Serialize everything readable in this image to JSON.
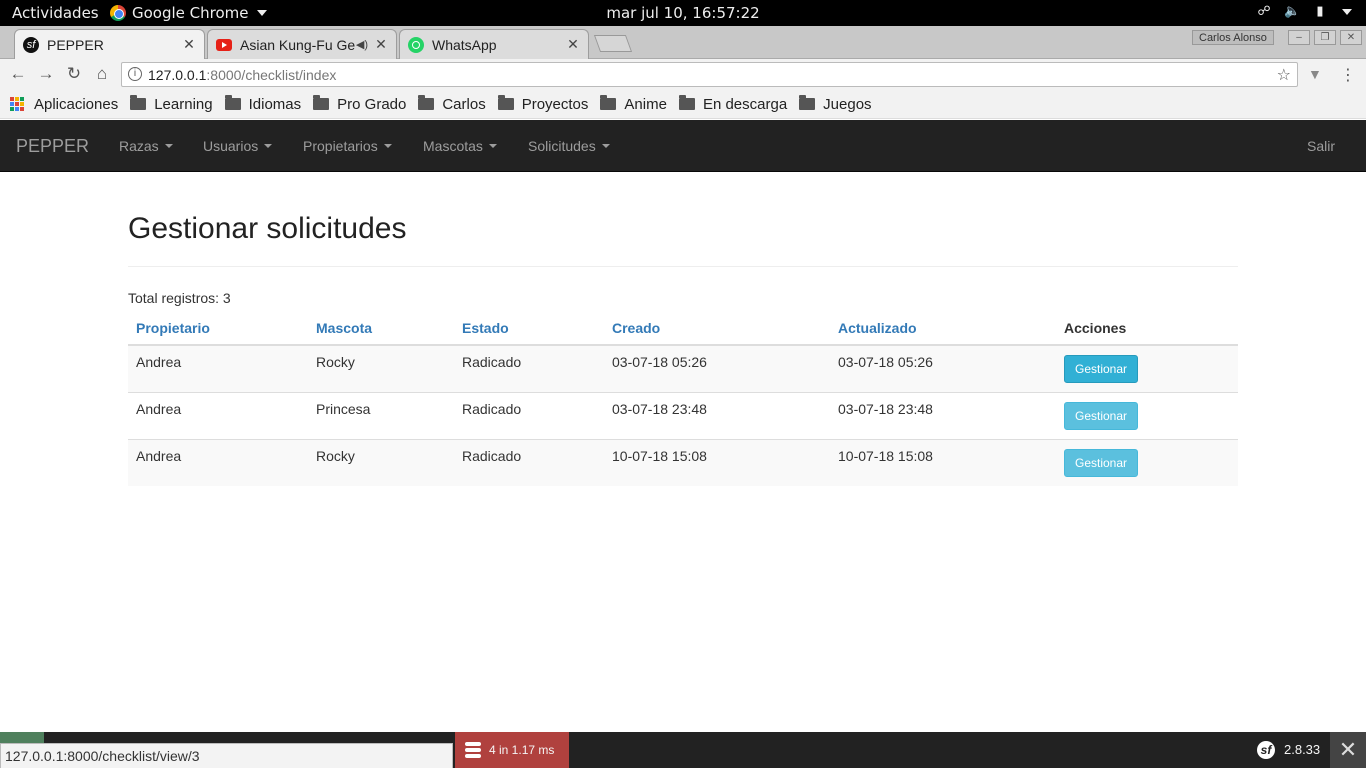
{
  "gnome": {
    "activities": "Actividades",
    "app": "Google Chrome",
    "clock": "mar jul 10, 16:57:22"
  },
  "tabs": [
    {
      "title": "PEPPER",
      "favicon": "symfony-icon"
    },
    {
      "title": "Asian Kung-Fu Ge",
      "favicon": "youtube-icon"
    },
    {
      "title": "WhatsApp",
      "favicon": "whatsapp-icon"
    }
  ],
  "profile": "Carlos Alonso",
  "address": {
    "host": "127.0.0.1",
    "rest": ":8000/checklist/index"
  },
  "bookmarks": [
    "Aplicaciones",
    "Learning",
    "Idiomas",
    "Pro Grado",
    "Carlos",
    "Proyectos",
    "Anime",
    "En descarga",
    "Juegos"
  ],
  "navbar": {
    "brand": "PEPPER",
    "items": [
      "Razas",
      "Usuarios",
      "Propietarios",
      "Mascotas",
      "Solicitudes"
    ],
    "logout": "Salir"
  },
  "page": {
    "title": "Gestionar solicitudes",
    "total": "Total registros: 3"
  },
  "table": {
    "headers": [
      "Propietario",
      "Mascota",
      "Estado",
      "Creado",
      "Actualizado",
      "Acciones"
    ],
    "rows": [
      {
        "propietario": "Andrea",
        "mascota": "Rocky",
        "estado": "Radicado",
        "creado": "03-07-18 05:26",
        "actualizado": "03-07-18 05:26",
        "accion": "Gestionar"
      },
      {
        "propietario": "Andrea",
        "mascota": "Princesa",
        "estado": "Radicado",
        "creado": "03-07-18 23:48",
        "actualizado": "03-07-18 23:48",
        "accion": "Gestionar"
      },
      {
        "propietario": "Andrea",
        "mascota": "Rocky",
        "estado": "Radicado",
        "creado": "10-07-18 15:08",
        "actualizado": "10-07-18 15:08",
        "accion": "Gestionar"
      }
    ]
  },
  "symfony": {
    "db": "4 in 1.17 ms",
    "version": "2.8.33"
  },
  "status_url": "127.0.0.1:8000/checklist/view/3"
}
